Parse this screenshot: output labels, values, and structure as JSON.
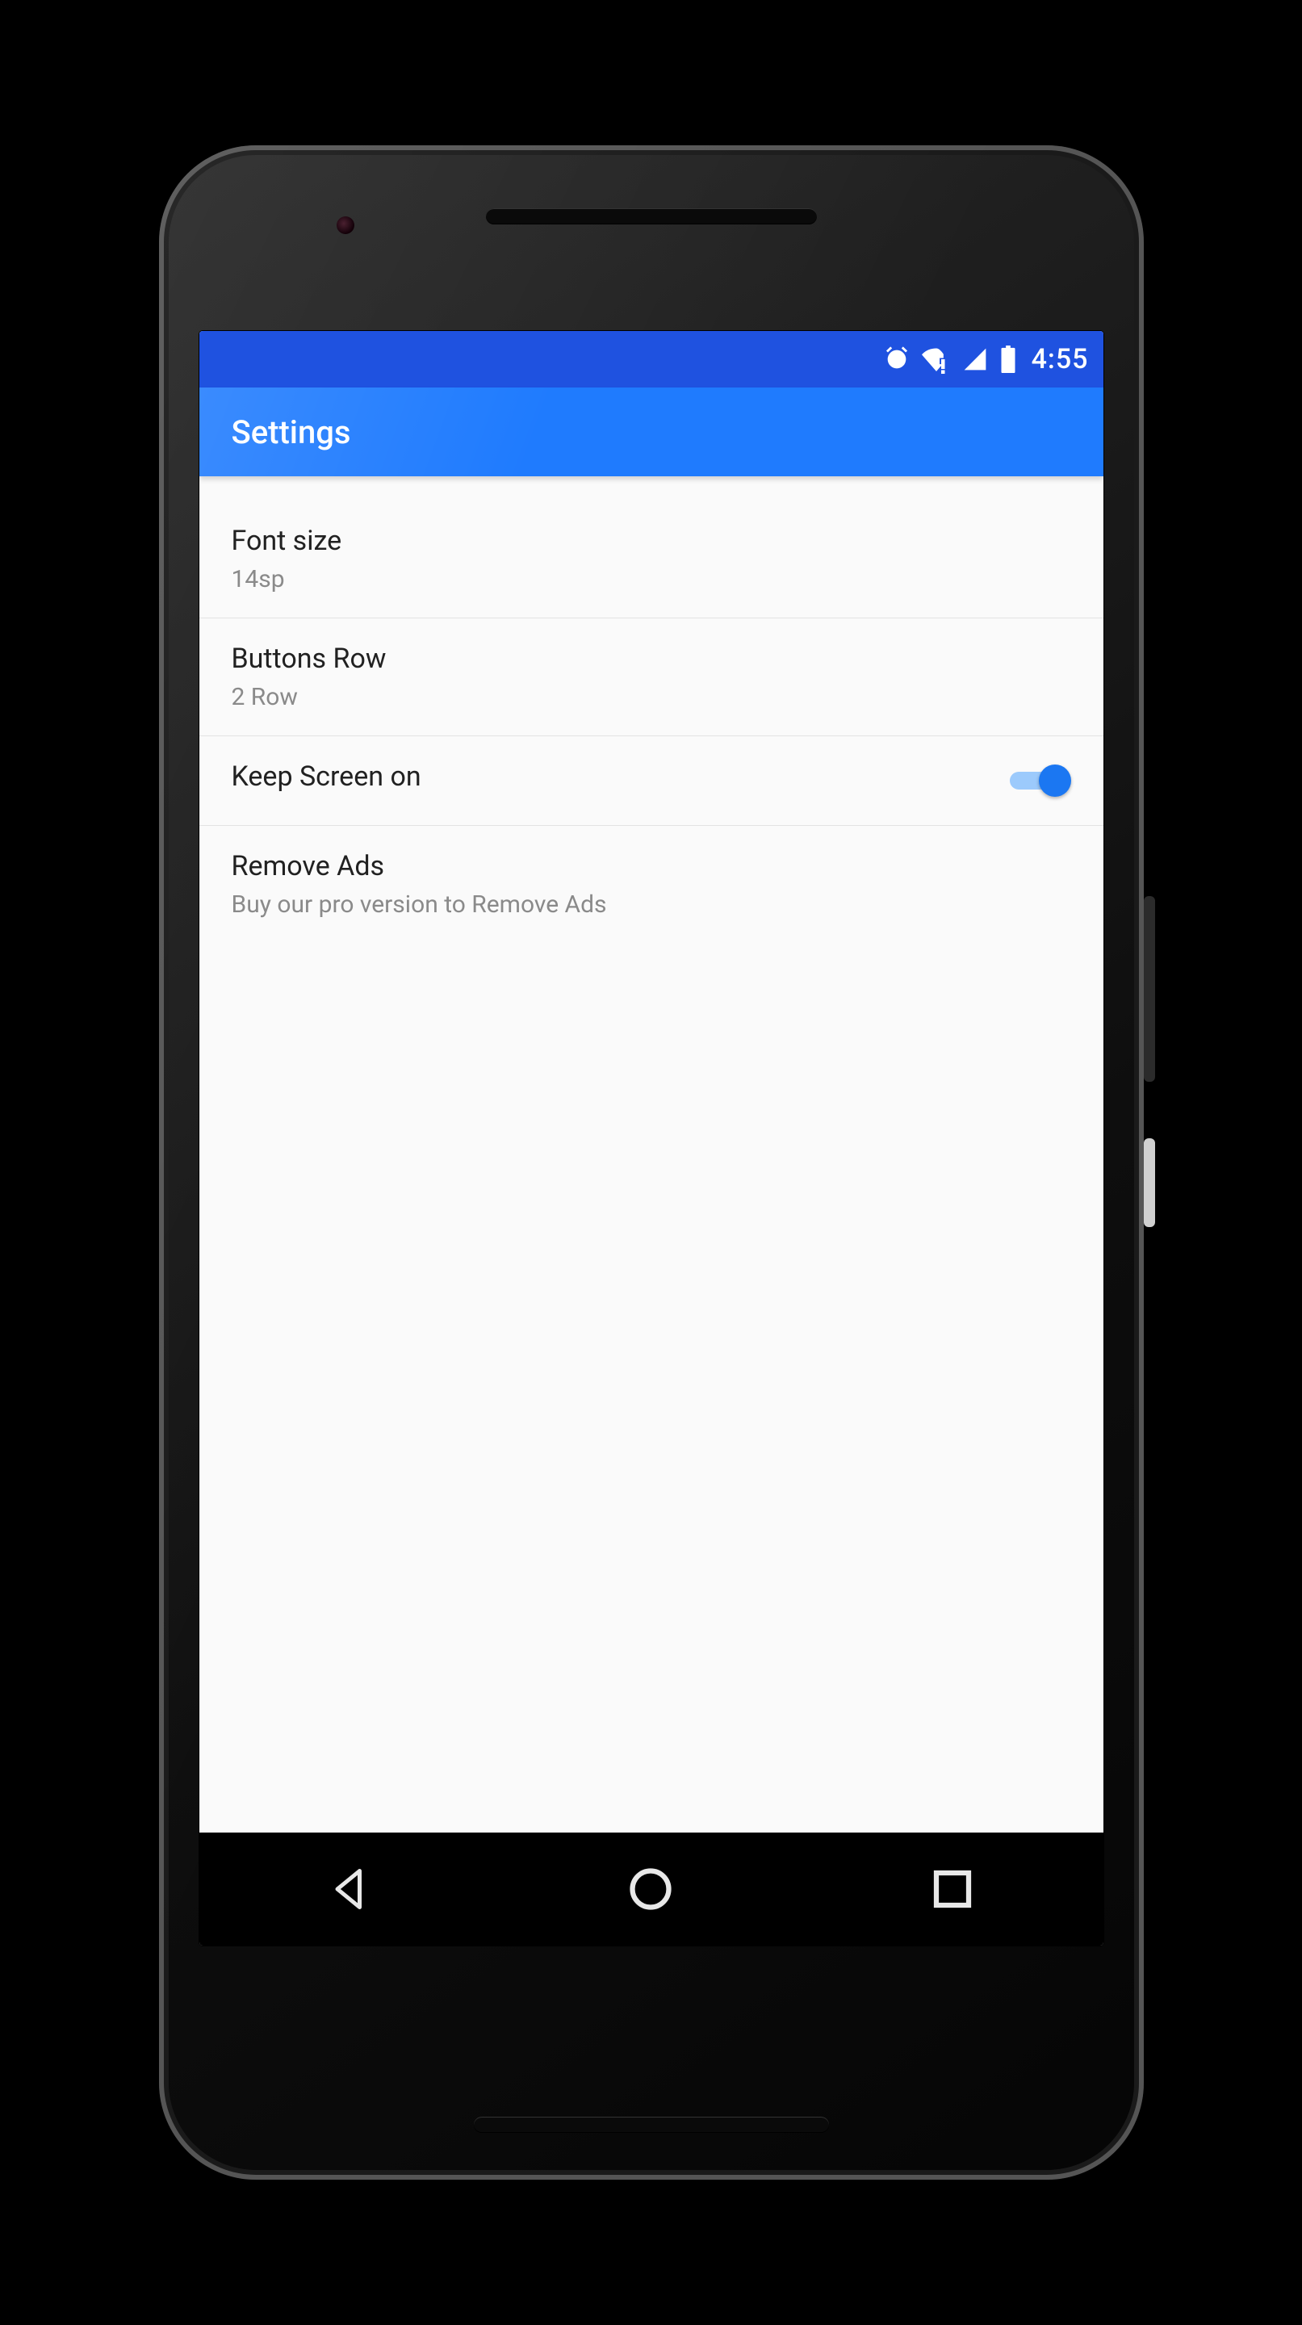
{
  "status": {
    "time": "4:55"
  },
  "appbar": {
    "title": "Settings"
  },
  "settings": {
    "font_size": {
      "title": "Font size",
      "value": "14sp"
    },
    "buttons_row": {
      "title": "Buttons Row",
      "value": "2 Row"
    },
    "keep_screen": {
      "title": "Keep Screen on",
      "value": "on"
    },
    "remove_ads": {
      "title": "Remove Ads",
      "value": "Buy our pro version to Remove Ads"
    }
  }
}
